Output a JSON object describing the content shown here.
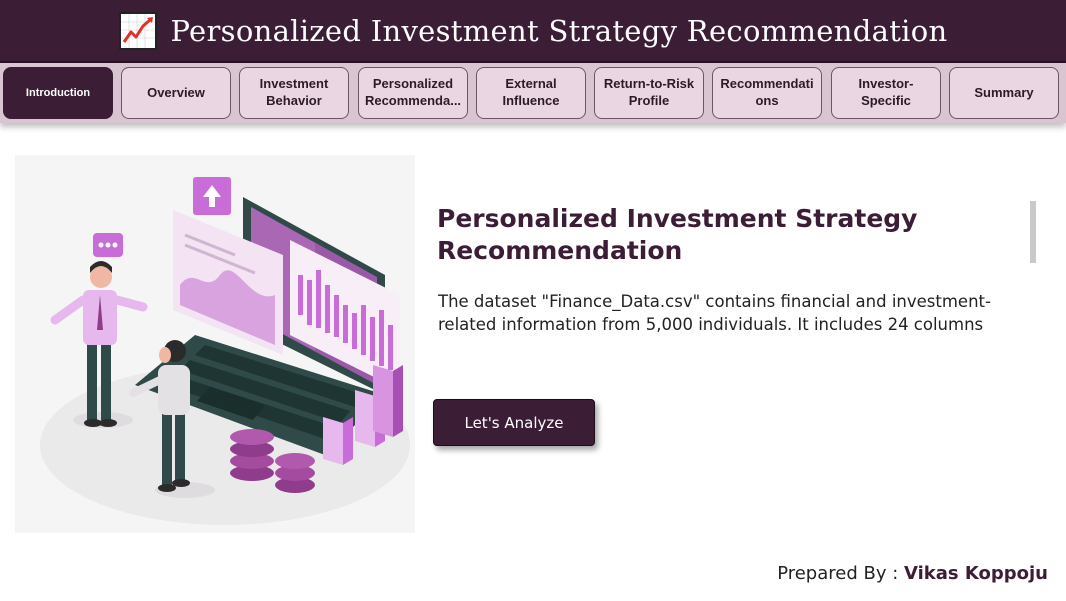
{
  "header": {
    "title": "Personalized Investment Strategy Recommendation",
    "icon": "chart-increasing-icon"
  },
  "tabs": [
    {
      "label": "Introduction",
      "active": true
    },
    {
      "label": "Overview",
      "active": false
    },
    {
      "label": "Investment Behavior",
      "active": false
    },
    {
      "label": "Personalized Recommenda...",
      "active": false
    },
    {
      "label": "External Influence",
      "active": false
    },
    {
      "label": "Return-to-Risk Profile",
      "active": false
    },
    {
      "label": "Recommendati ons",
      "active": false
    },
    {
      "label": "Investor-Specific",
      "active": false
    },
    {
      "label": "Summary",
      "active": false
    }
  ],
  "main": {
    "title": "Personalized Investment Strategy Recommendation",
    "description": "The dataset \"Finance_Data.csv\" contains financial and investment-related information from 5,000 individuals. It includes 24 columns",
    "cta_label": "Let's Analyze"
  },
  "footer": {
    "prepared_label": "Prepared By : ",
    "author": "Vikas Koppoju"
  },
  "colors": {
    "primary": "#3b1d35",
    "tab_bg": "#ead6e3",
    "tabbar_bg": "#d9c4d2",
    "accent_pink": "#c86dd7"
  }
}
